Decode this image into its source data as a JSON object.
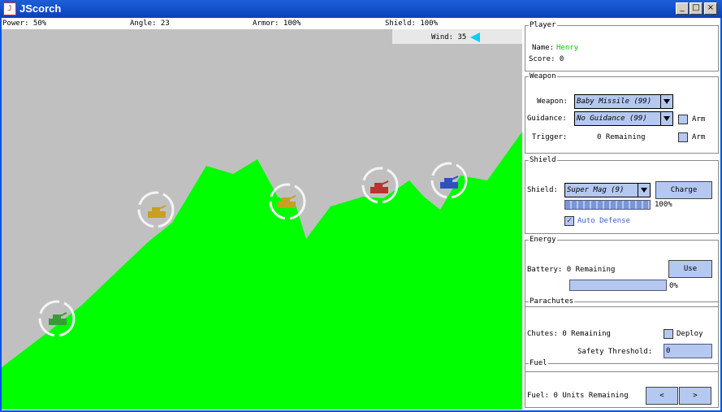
{
  "window": {
    "title": "JScorch",
    "icon_text": "J"
  },
  "status": {
    "power": "Power: 50%",
    "angle": "Angle: 23",
    "armor": "Armor: 100%",
    "shield": "Shield: 100%",
    "wind": "Wind: 35"
  },
  "player": {
    "legend": "Player",
    "name_label": "Name:",
    "name": "Henry",
    "score": "Score: 0"
  },
  "weapon": {
    "legend": "Weapon",
    "weapon_label": "Weapon:",
    "weapon_value": "Baby Missile (99)",
    "guidance_label": "Guidance:",
    "guidance_value": "No Guidance (99)",
    "arm_label": "Arm",
    "trigger_label": "Trigger:",
    "trigger_value": "0 Remaining",
    "arm2_label": "Arm"
  },
  "shield": {
    "legend": "Shield",
    "shield_label": "Shield:",
    "shield_value": "Super Mag (9)",
    "charge_label": "Charge",
    "percent": "100%",
    "level": 1.0,
    "auto_defense": "Auto Defense"
  },
  "energy": {
    "legend": "Energy",
    "battery": "Battery: 0 Remaining",
    "use_label": "Use",
    "percent": "0%"
  },
  "parachutes": {
    "legend": "Parachutes",
    "chutes": "Chutes: 0 Remaining",
    "deploy_label": "Deploy",
    "threshold_label": "Safety Threshold:",
    "threshold_value": "0"
  },
  "fuel": {
    "legend": "Fuel",
    "units": "Fuel: 0 Units Remaining",
    "left_label": "<",
    "right_label": ">"
  },
  "colors": {
    "terrain": "#00ff00",
    "sky": "#c0c0c0",
    "tank_green": "#3a9a3a",
    "tank_yellow": "#c8a020",
    "tank_red": "#c03030",
    "tank_blue": "#3050c0"
  }
}
